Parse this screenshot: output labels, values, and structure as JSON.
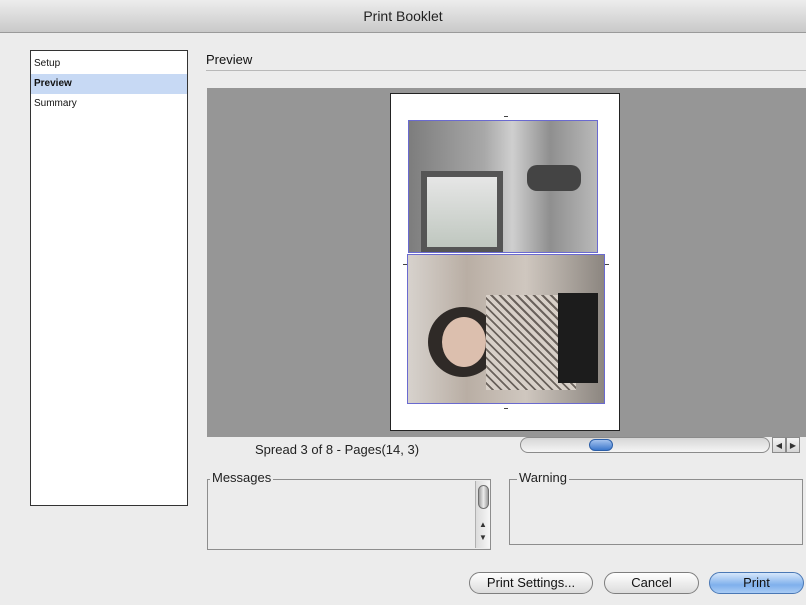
{
  "window": {
    "title": "Print Booklet"
  },
  "sidebar": {
    "items": [
      {
        "label": "Setup",
        "selected": false
      },
      {
        "label": "Preview",
        "selected": true
      },
      {
        "label": "Summary",
        "selected": false
      }
    ]
  },
  "preview": {
    "section_title": "Preview",
    "spread_label": "Spread 3 of 8 - Pages(14, 3)"
  },
  "messages": {
    "label": "Messages"
  },
  "warning": {
    "label": "Warning"
  },
  "buttons": {
    "print_settings": "Print Settings...",
    "cancel": "Cancel",
    "print": "Print"
  },
  "colors": {
    "selection": "#c7d9f4",
    "preview_bg": "#969696",
    "frame_border": "#6a6ad0",
    "primary_button": "#7fb0ec"
  }
}
